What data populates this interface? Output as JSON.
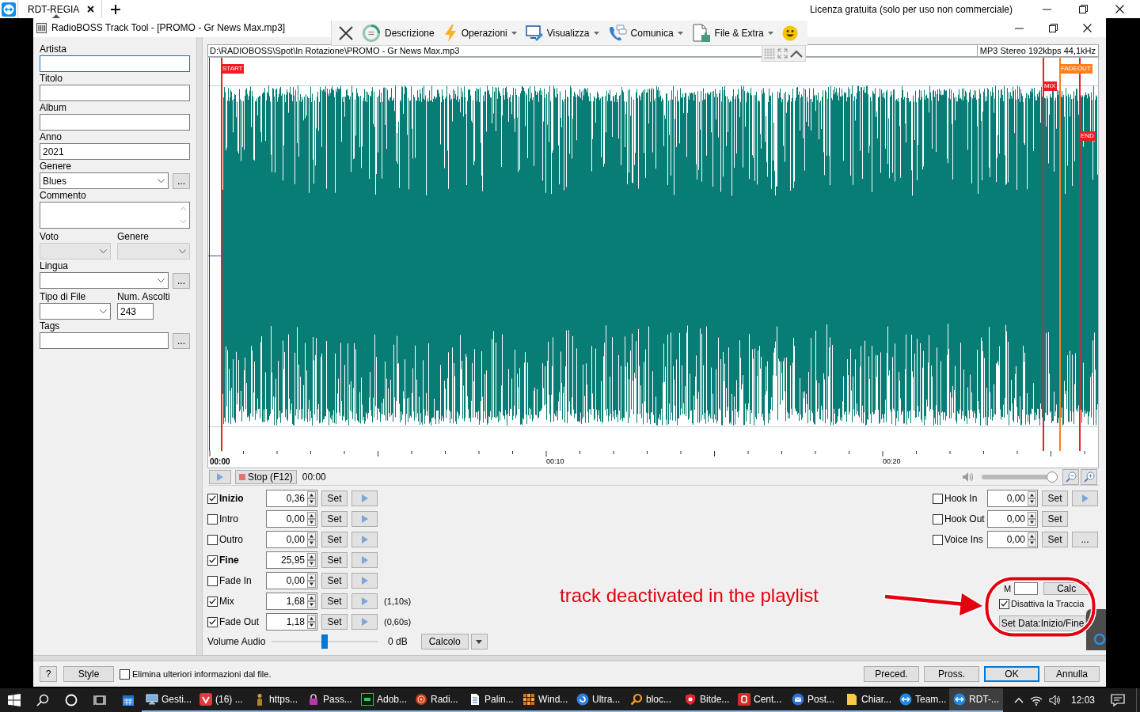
{
  "remote_session": {
    "tab": "RDT-REGIA",
    "license_notice": "Licenza gratuita (solo per uso non commerciale)"
  },
  "window": {
    "title": "RadioBOSS Track Tool - [PROMO - Gr News Max.mp3]"
  },
  "toolbar": [
    {
      "label": "Descrizione",
      "dropdown": false
    },
    {
      "label": "Operazioni",
      "dropdown": true
    },
    {
      "label": "Visualizza",
      "dropdown": true
    },
    {
      "label": "Comunica",
      "dropdown": true
    },
    {
      "label": "File & Extra",
      "dropdown": true
    }
  ],
  "tags_panel": {
    "rows": [
      [
        {
          "label": "Artista",
          "kind": "text",
          "focused": true,
          "disabled": false
        }
      ],
      [
        {
          "label": "Titolo",
          "kind": "text",
          "focused": false,
          "disabled": false
        }
      ],
      [
        {
          "label": "Album",
          "kind": "text",
          "focused": false,
          "disabled": false
        }
      ],
      [
        {
          "label": "Anno",
          "kind": "text",
          "value": "2021",
          "focused": false,
          "disabled": false
        }
      ],
      [
        {
          "label": "Genere",
          "kind": "combo",
          "value": "Blues",
          "button": "...",
          "focused": false,
          "disabled": false
        }
      ],
      [
        {
          "label": "Commento",
          "kind": "memo",
          "focused": false,
          "disabled": false
        }
      ],
      [
        {
          "label": "Voto",
          "kind": "combo",
          "focused": false,
          "disabled": true
        },
        {
          "label": "Genere",
          "kind": "combo",
          "focused": false,
          "disabled": true
        }
      ],
      [
        {
          "label": "Lingua",
          "kind": "combo",
          "button": "...",
          "focused": false,
          "disabled": false
        }
      ],
      [
        {
          "label": "Tipo di File",
          "kind": "combo",
          "focused": false,
          "disabled": false
        },
        {
          "label": "Num. Ascolti",
          "kind": "text",
          "value": "243",
          "focused": false,
          "disabled": false
        }
      ],
      [
        {
          "label": "Tags",
          "kind": "text",
          "button": "...",
          "focused": false,
          "disabled": false
        }
      ]
    ]
  },
  "path_bar": {
    "path": "D:\\RADIOBOSS\\Spot\\In Rotazione\\PROMO - Gr News Max.mp3",
    "format": "MP3 Stereo 192kbps 44,1kHz"
  },
  "waveform": {
    "markers": [
      {
        "label": "START",
        "color": "#ee1c25"
      },
      {
        "label": "MIX",
        "color": "#ee1c25"
      },
      {
        "label": "FADEOUT",
        "color": "#ff7f1e"
      },
      {
        "label": "END",
        "color": "#ee1c25"
      }
    ],
    "time_labels": [
      "00:00",
      "00:10",
      "00:20"
    ]
  },
  "transport": {
    "stop_button": "Stop (F12)",
    "time": "00:00",
    "preview_volume": {
      "level": 1
    }
  },
  "cues_left": [
    {
      "label": "Inizio",
      "checked": true,
      "emphasized": true,
      "value": "0,36",
      "set_button": "Set",
      "extra": {
        "kind": "play"
      }
    },
    {
      "label": "Intro",
      "checked": false,
      "emphasized": false,
      "value": "0,00",
      "set_button": "Set",
      "extra": {
        "kind": "play"
      }
    },
    {
      "label": "Outro",
      "checked": false,
      "emphasized": false,
      "value": "0,00",
      "set_button": "Set",
      "extra": {
        "kind": "play"
      }
    },
    {
      "label": "Fine",
      "checked": true,
      "emphasized": true,
      "value": "25,95",
      "set_button": "Set",
      "extra": {
        "kind": "play"
      }
    },
    {
      "label": "Fade In",
      "checked": false,
      "emphasized": false,
      "value": "0,00",
      "set_button": "Set",
      "extra": {
        "kind": "play"
      }
    },
    {
      "label": "Mix",
      "checked": true,
      "emphasized": false,
      "value": "1,68",
      "set_button": "Set",
      "extra": {
        "kind": "play"
      },
      "duration": "(1,10s)"
    },
    {
      "label": "Fade Out",
      "checked": true,
      "emphasized": false,
      "value": "1,18",
      "set_button": "Set",
      "extra": {
        "kind": "play"
      },
      "duration": "(0,60s)"
    }
  ],
  "volume": {
    "label": "Volume Audio",
    "level": 0.5,
    "reading": "0 dB",
    "button": "Calcolo"
  },
  "cues_right": [
    {
      "label": "Hook In",
      "checked": false,
      "value": "0,00",
      "set_button": "Set",
      "extra": {
        "kind": "play"
      }
    },
    {
      "label": "Hook Out",
      "checked": false,
      "value": "0,00",
      "set_button": "Set"
    },
    {
      "label": "Voice Ins",
      "checked": false,
      "value": "0,00",
      "set_button": "Set",
      "extra": {
        "kind": "text",
        "label": "..."
      }
    }
  ],
  "partial_row": {
    "label": "M",
    "button": "Calc"
  },
  "deactivate": {
    "label": "Disattiva la Traccia",
    "checked": true
  },
  "set_data_button": "Set Data:Inizio/Fine",
  "annotation": {
    "text": "track deactivated in the playlist"
  },
  "bottom_bar": {
    "help_button": "?",
    "style_button": "Style",
    "strip_option": {
      "label": "Elimina ulteriori informazioni dal file.",
      "checked": false
    },
    "buttons": [
      {
        "label": "Preced.",
        "default": false
      },
      {
        "label": "Pross.",
        "default": false
      },
      {
        "label": "OK",
        "default": true
      },
      {
        "label": "Annulla",
        "default": false
      }
    ]
  },
  "taskbar": {
    "items": [
      {
        "selected": false
      },
      {
        "label": "Gesti...",
        "selected": false
      },
      {
        "label": "(16) ...",
        "selected": false
      },
      {
        "label": "https...",
        "selected": false
      },
      {
        "label": "Pass...",
        "selected": false
      },
      {
        "label": "Adob...",
        "selected": false
      },
      {
        "label": "Radi...",
        "selected": false
      },
      {
        "label": "Palin...",
        "selected": false
      },
      {
        "label": "Wind...",
        "selected": false
      },
      {
        "label": "Ultra...",
        "selected": false
      },
      {
        "label": "bloc...",
        "selected": false
      },
      {
        "label": "Bitde...",
        "selected": false
      },
      {
        "label": "Cent...",
        "selected": false
      },
      {
        "label": "Post...",
        "selected": false
      },
      {
        "label": "Chiar...",
        "selected": false
      },
      {
        "label": "Team...",
        "selected": false
      },
      {
        "label": "RDT-...",
        "selected": true
      }
    ],
    "clock": "12:03"
  }
}
